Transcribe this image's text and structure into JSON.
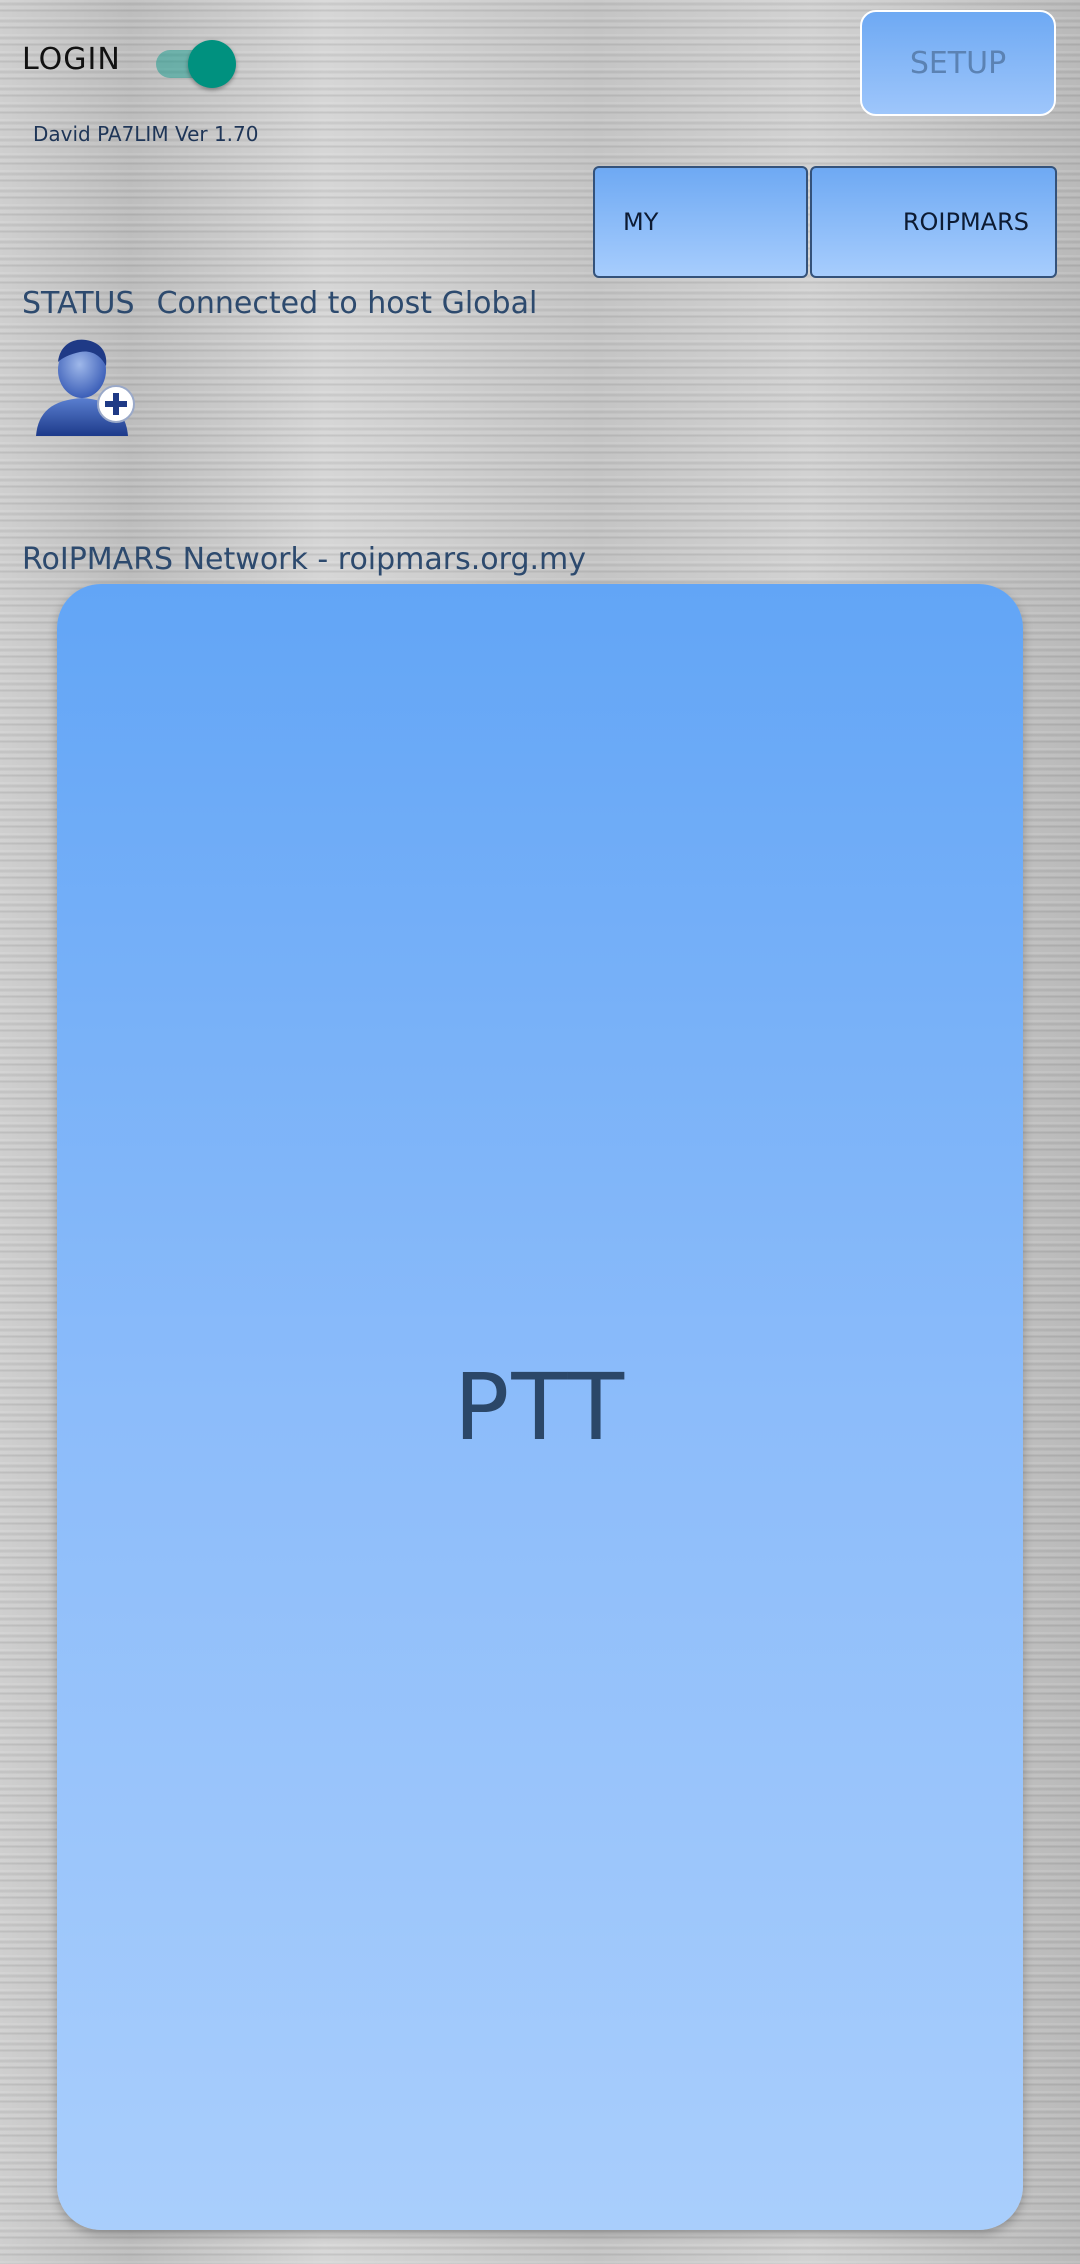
{
  "header": {
    "login_label": "LOGIN",
    "login_toggle_on": true,
    "version_text": "David PA7LIM  Ver 1.70",
    "setup_label": "SETUP"
  },
  "mode_buttons": {
    "my_label": "MY",
    "roipmars_label": "ROIPMARS"
  },
  "status": {
    "label": "STATUS",
    "text": "Connected to host Global"
  },
  "network": {
    "text": "RoIPMARS Network - roipmars.org.my"
  },
  "ptt": {
    "label": "PTT"
  },
  "icons": {
    "add_user": "add-user-icon"
  },
  "colors": {
    "toggle_on": "#00917f",
    "button_blue": "#6ea9f3",
    "text_blue": "#2d4a6e"
  }
}
